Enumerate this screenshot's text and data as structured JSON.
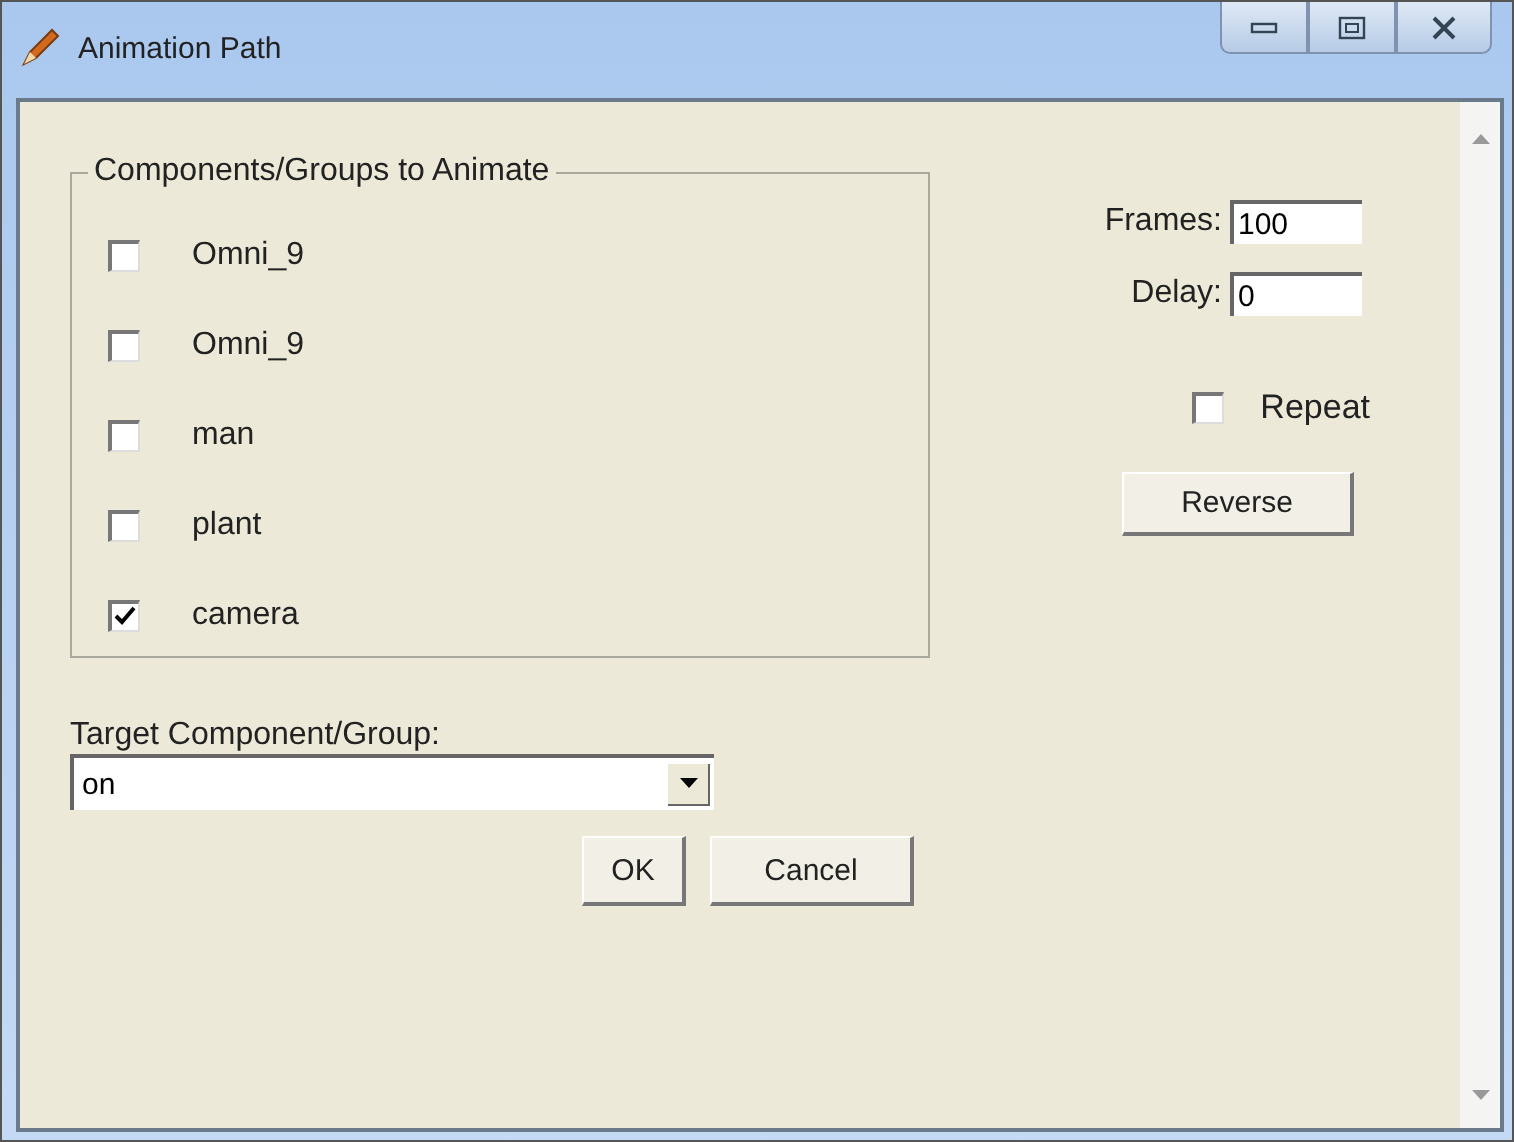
{
  "window": {
    "title": "Animation Path"
  },
  "group": {
    "title": "Components/Groups to Animate",
    "items": [
      {
        "label": "Omni_9",
        "checked": false
      },
      {
        "label": "Omni_9",
        "checked": false
      },
      {
        "label": "man",
        "checked": false
      },
      {
        "label": "plant",
        "checked": false
      },
      {
        "label": "camera",
        "checked": true
      }
    ]
  },
  "fields": [
    {
      "label": "Frames:",
      "value": "100"
    },
    {
      "label": "Delay:",
      "value": "0"
    }
  ],
  "repeat": {
    "label": "Repeat",
    "checked": false
  },
  "reverse_button": "Reverse",
  "target": {
    "label": "Target Component/Group:",
    "value": "on"
  },
  "buttons": [
    "OK",
    "Cancel"
  ]
}
